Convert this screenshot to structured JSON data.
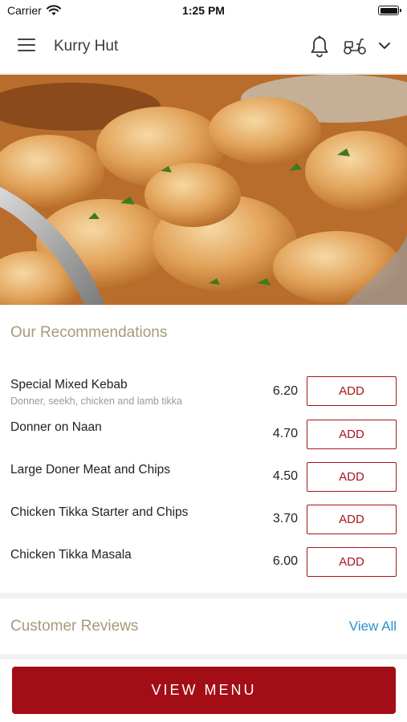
{
  "status_bar": {
    "carrier": "Carrier",
    "time": "1:25 PM"
  },
  "header": {
    "title": "Kurry Hut",
    "icons": [
      "hamburger-menu-icon",
      "bell-icon",
      "scooter-icon",
      "chevron-down-icon"
    ]
  },
  "hero": {
    "image": "chicken-curry-dish-photo"
  },
  "recommendations": {
    "title": "Our Recommendations",
    "add_label": "ADD",
    "items": [
      {
        "name": "Special Mixed Kebab",
        "description": "Donner, seekh, chicken and lamb tikka",
        "price": "6.20"
      },
      {
        "name": "Donner on Naan",
        "description": "",
        "price": "4.70"
      },
      {
        "name": "Large Doner Meat and Chips",
        "description": "",
        "price": "4.50"
      },
      {
        "name": "Chicken Tikka Starter and Chips",
        "description": "",
        "price": "3.70"
      },
      {
        "name": "Chicken Tikka Masala",
        "description": "",
        "price": "6.00"
      }
    ]
  },
  "reviews": {
    "title": "Customer Reviews",
    "view_all": "View All"
  },
  "footer": {
    "view_menu": "VIEW MENU"
  },
  "colors": {
    "brand_red": "#a30e16",
    "section_title": "#a89a7a",
    "link_blue": "#2d8fd0"
  }
}
